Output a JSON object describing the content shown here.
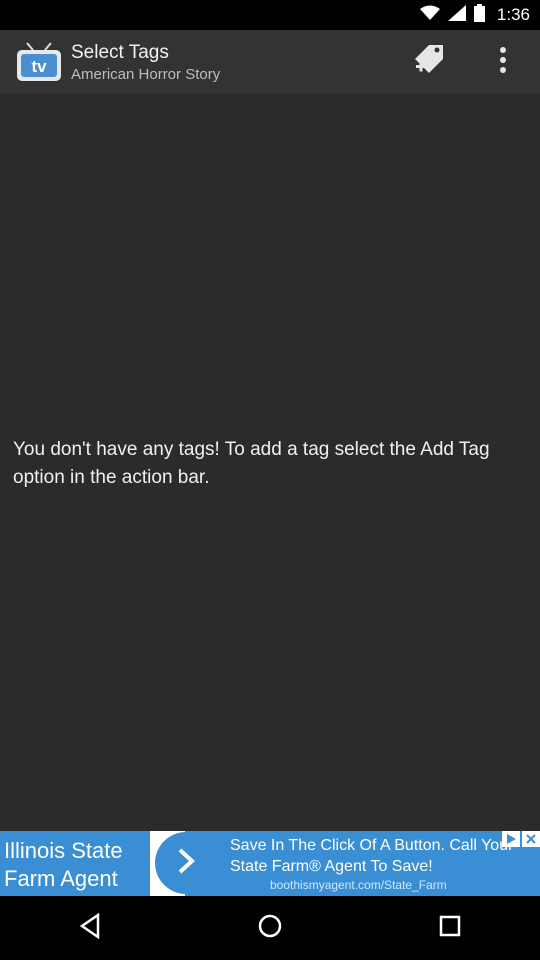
{
  "status_bar": {
    "time": "1:36",
    "icons": [
      "wifi-icon",
      "signal-icon",
      "battery-icon"
    ]
  },
  "action_bar": {
    "title": "Select Tags",
    "subtitle": "American Horror Story",
    "app_icon": "tv-icon",
    "actions": [
      "add-tag-icon",
      "overflow-menu-icon"
    ]
  },
  "content": {
    "empty_message": "You don't have any tags! To add a tag select the Add Tag option in the action bar."
  },
  "ad": {
    "left_text": "Illinois State Farm Agent",
    "headline": "Save In The Click Of A Button. Call Your State Farm® Agent To Save!",
    "url": "boothismyagent.com/State_Farm",
    "icons": [
      "ad-info-icon",
      "ad-close-icon"
    ]
  },
  "nav_bar": {
    "buttons": [
      "back-icon",
      "home-icon",
      "recents-icon"
    ]
  },
  "colors": {
    "action_bar": "#333335",
    "content_bg": "#2b2b2d",
    "ad_blue": "#3a8fd4"
  }
}
